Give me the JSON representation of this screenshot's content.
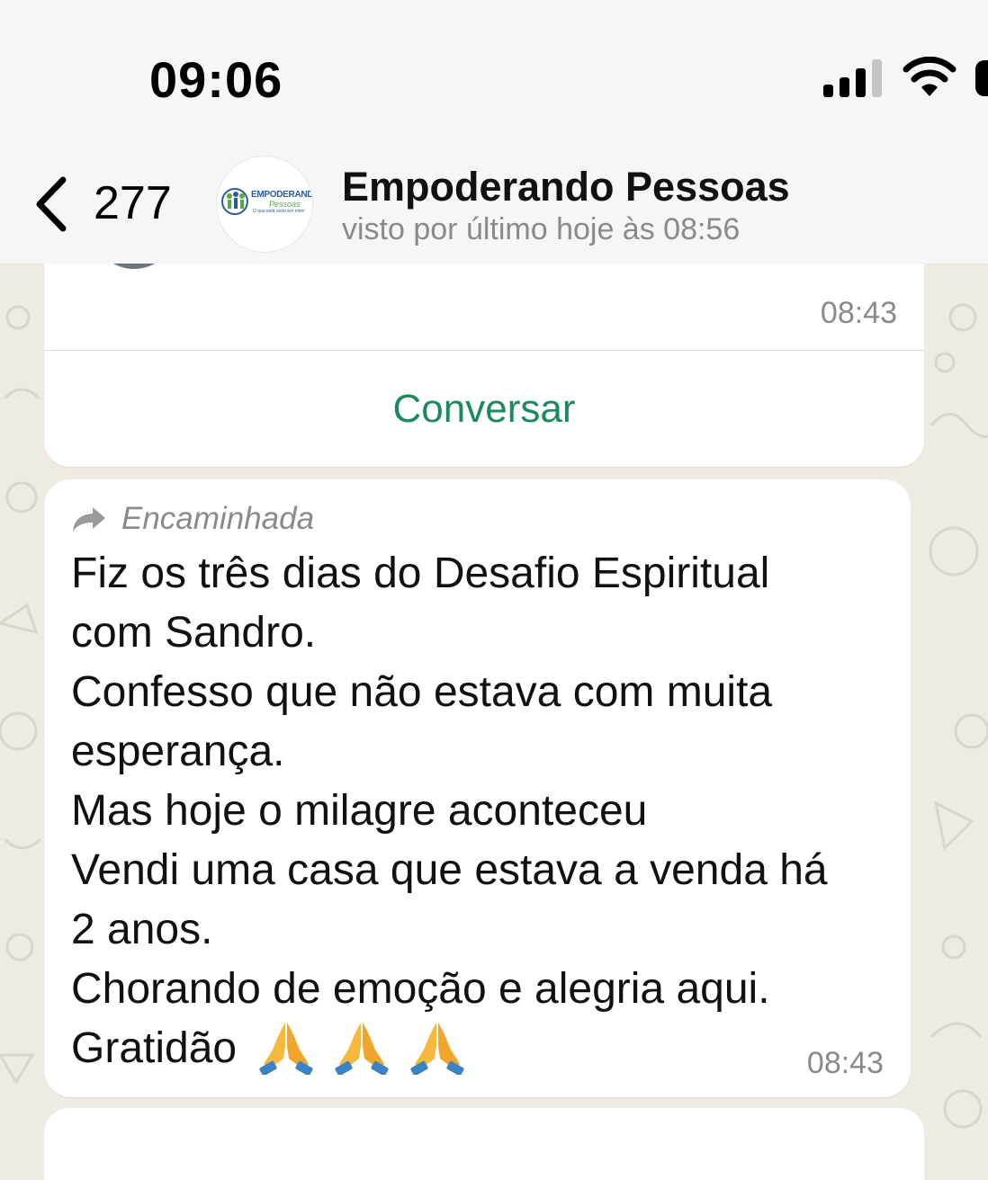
{
  "status_bar": {
    "time": "09:06",
    "icons": [
      "cellular-signal-icon",
      "wifi-icon",
      "battery-icon"
    ]
  },
  "header": {
    "back_count": "277",
    "contact_name": "Empoderando Pessoas",
    "last_seen": "visto por último hoje às 08:56",
    "avatar_logo": {
      "line1": "EMPODERANDO",
      "line2": "Pessoas",
      "tagline": "O que está certo em mim!"
    }
  },
  "messages": [
    {
      "type": "card",
      "time": "08:43",
      "button_label": "Conversar"
    },
    {
      "type": "text",
      "forwarded_label": "Encaminhada",
      "lines": [
        "Fiz os três dias do Desafio Espiritual",
        "com Sandro.",
        "Confesso que não estava com muita",
        "esperança.",
        "Mas hoje o milagre aconteceu",
        "Vendi uma casa que estava a venda há",
        "2 anos.",
        "Chorando de emoção e alegria aqui.",
        "Gratidão"
      ],
      "emojis": [
        "folded-hands-icon",
        "folded-hands-icon",
        "folded-hands-icon"
      ],
      "time": "08:43"
    }
  ],
  "colors": {
    "chat_background": "#efeae2",
    "header_background": "#f6f6f6",
    "accent_green": "#1c8a5d",
    "meta_gray": "#8a8a8a"
  }
}
